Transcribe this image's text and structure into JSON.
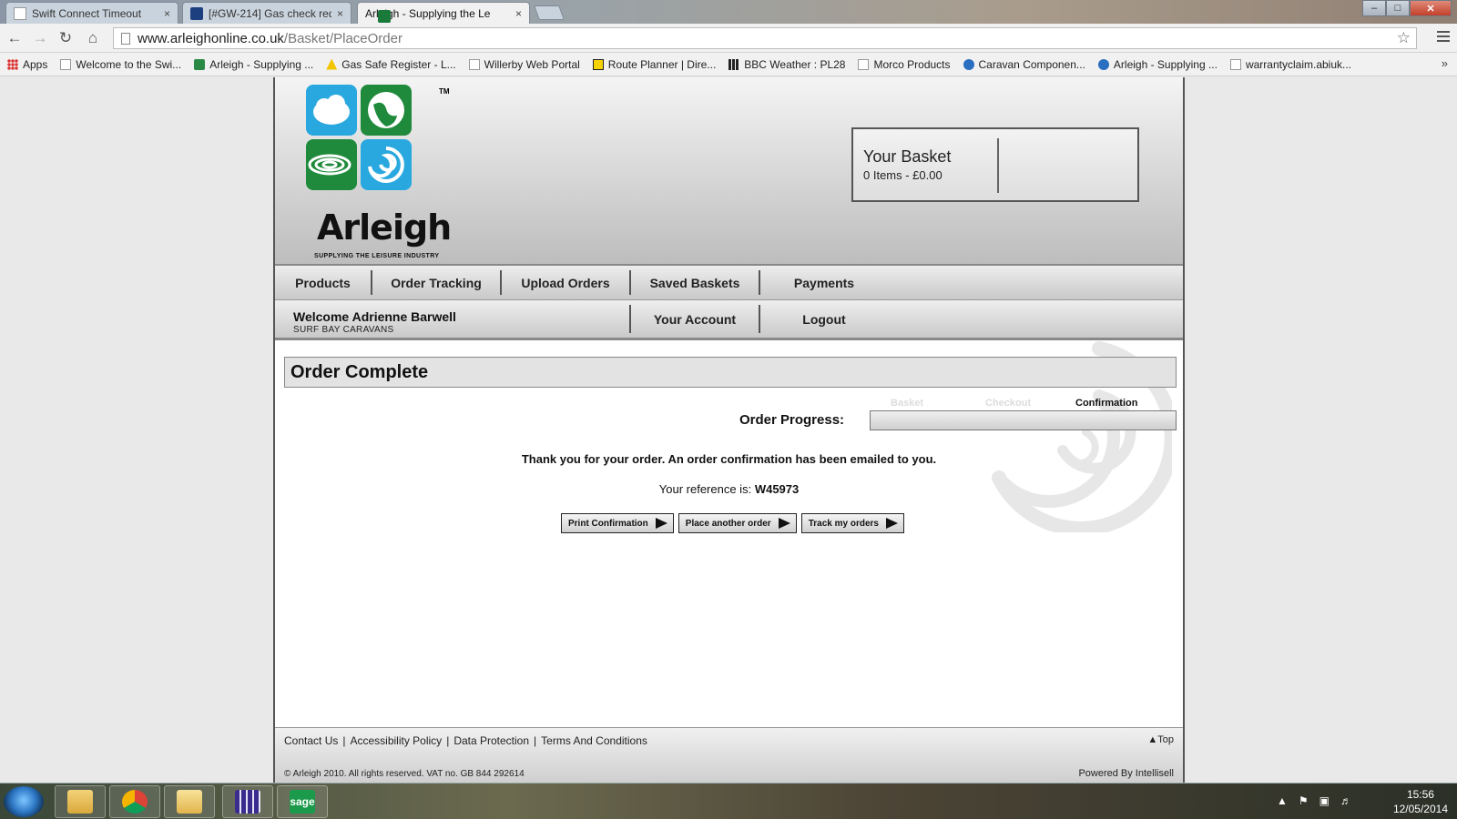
{
  "browser": {
    "tabs": [
      {
        "label": "Swift Connect Timeout",
        "close": "×"
      },
      {
        "label": "[#GW-214] Gas check requ",
        "close": "×"
      },
      {
        "label": "Arleigh - Supplying the Le",
        "close": "×"
      }
    ],
    "window_controls": {
      "minimize": "–",
      "maximize": "□",
      "close": "✕"
    },
    "url_host": "www.arleighonline.co.uk",
    "url_path": "/Basket/PlaceOrder",
    "bookmarks": [
      "Apps",
      "Welcome to the Swi...",
      "Arleigh - Supplying ...",
      "Gas Safe Register - L...",
      "Willerby Web Portal",
      "Route Planner | Dire...",
      "BBC Weather : PL28",
      "Morco Products",
      "Caravan Componen...",
      "Arleigh - Supplying ...",
      "warrantyclaim.abiuk..."
    ],
    "bookmarks_more": "»"
  },
  "header": {
    "brand": "Arleigh",
    "tagline": "SUPPLYING THE LEISURE INDUSTRY",
    "trademark": "TM",
    "basket_title": "Your Basket",
    "basket_summary": "0 Items - £0.00"
  },
  "nav": {
    "primary": [
      "Products",
      "Order Tracking",
      "Upload Orders",
      "Saved Baskets",
      "Payments"
    ],
    "welcome_name": "Welcome Adrienne Barwell",
    "welcome_company": "SURF BAY CARAVANS",
    "secondary": [
      "Your Account",
      "Logout"
    ]
  },
  "main": {
    "title": "Order Complete",
    "progress_label": "Order Progress:",
    "progress_steps": [
      {
        "label": "Basket",
        "state": "done"
      },
      {
        "label": "Checkout",
        "state": "done"
      },
      {
        "label": "Confirmation",
        "state": "current"
      }
    ],
    "thanks": "Thank you for your order. An order confirmation has been emailed to you.",
    "reference_label": "Your reference is:",
    "reference": "W45973",
    "buttons": [
      "Print Confirmation",
      "Place another order",
      "Track my orders"
    ]
  },
  "footer": {
    "links": [
      "Contact Us",
      "Accessibility Policy",
      "Data Protection",
      "Terms And Conditions"
    ],
    "separator": "|",
    "top_link": "▲Top",
    "copyright": "© Arleigh 2010. All rights reserved. VAT no. GB 844 292614",
    "powered": "Powered By Intellisell"
  },
  "taskbar": {
    "time": "15:56",
    "date": "12/05/2014",
    "tray_arrow": "▲",
    "sage_label": "sage"
  },
  "colors": {
    "brand_blue": "#29a8e0",
    "brand_green": "#1f8a3b",
    "step_done": "#dcdcdc",
    "step_current": "#111111"
  }
}
